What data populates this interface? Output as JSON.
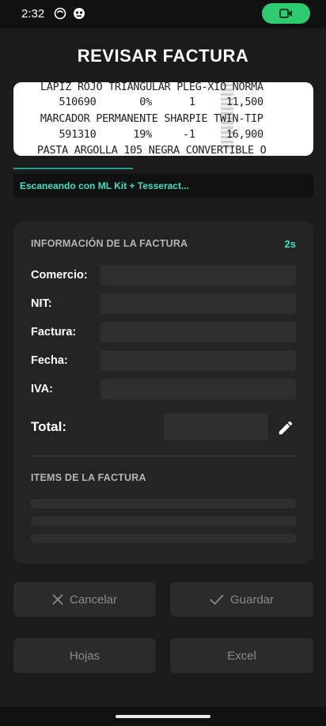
{
  "status_bar": {
    "time": "2:32"
  },
  "title": "REVISAR FACTURA",
  "receipt_lines": [
    "LAPIZ ROJO TRIANGULAR PLEG-XIO NORMA",
    "   510690       0%      1     11,500",
    " MARCADOR PERMANENTE SHARPIE TWIN-TIP",
    "   591310      19%     -1     16,900",
    " PASTA ARGOLLA 105 NEGRA CONVERTIBLE O"
  ],
  "scan_status": "Escaneando con ML Kit + Tesseract...",
  "scan_progress": 0.4,
  "invoice_section": {
    "title": "INFORMACIÓN DE LA FACTURA",
    "timer": "2s",
    "fields": [
      {
        "label": "Comercio:",
        "value": ""
      },
      {
        "label": "NIT:",
        "value": ""
      },
      {
        "label": "Factura:",
        "value": ""
      },
      {
        "label": "Fecha:",
        "value": ""
      },
      {
        "label": "IVA:",
        "value": ""
      }
    ],
    "total_label": "Total:",
    "total_value": ""
  },
  "items_section": {
    "title": "ITEMS DE LA FACTURA"
  },
  "buttons": {
    "cancel": "Cancelar",
    "save": "Guardar",
    "sheets": "Hojas",
    "excel": "Excel"
  },
  "icons": {
    "status_left_1": "notification-icon",
    "status_left_2": "app-icon",
    "status_pill": "video-camera-icon",
    "edit": "pencil-icon",
    "cancel": "close-icon",
    "save": "check-icon"
  },
  "colors": {
    "accent": "#3de0c2",
    "pill": "#2ecc71",
    "background": "#1b1b1b",
    "card": "#242424"
  }
}
